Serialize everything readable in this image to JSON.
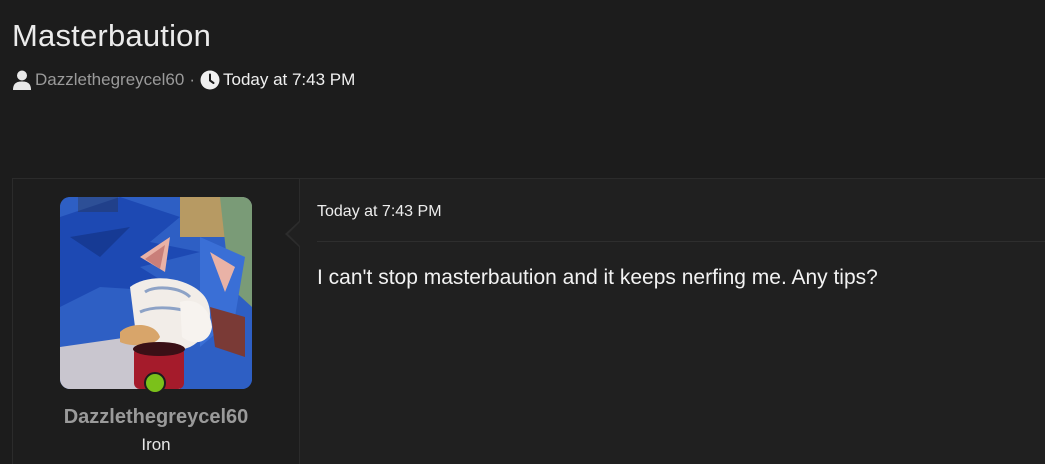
{
  "thread": {
    "title": "Masterbaution",
    "author": "Dazzlethegreycel60",
    "separator": "·",
    "date": "Today at 7:43 PM"
  },
  "icons": {
    "author": "user-icon",
    "date": "clock-icon"
  },
  "post": {
    "date": "Today at 7:43 PM",
    "body": "I can't stop masterbaution and it keeps nerfing me. Any tips?",
    "user": {
      "name": "Dazzlethegreycel60",
      "rank": "Iron",
      "online": true
    }
  },
  "colors": {
    "background": "#1c1c1c",
    "online": "#7bc11a"
  }
}
